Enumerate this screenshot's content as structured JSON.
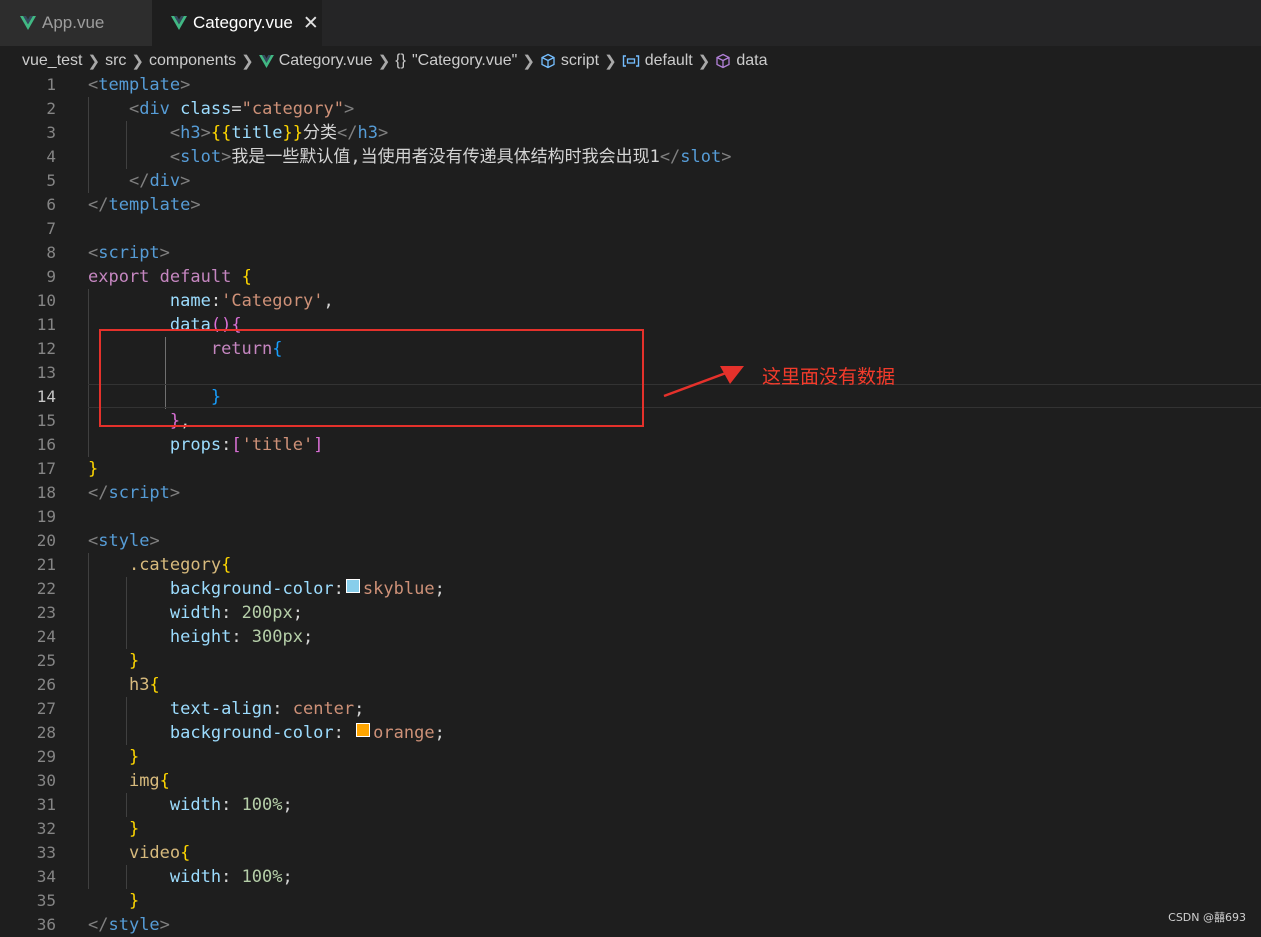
{
  "tabs": [
    {
      "label": "App.vue",
      "active": false,
      "icon": "vue-icon"
    },
    {
      "label": "Category.vue",
      "active": true,
      "icon": "vue-icon",
      "close": "✕"
    }
  ],
  "breadcrumb": {
    "project": "vue_test",
    "src": "src",
    "components": "components",
    "file": "Category.vue",
    "module_braces": "{}",
    "module": "\"Category.vue\"",
    "script": "script",
    "default": "default",
    "data": "data"
  },
  "code": {
    "line_numbers": [
      "1",
      "2",
      "3",
      "4",
      "5",
      "6",
      "7",
      "8",
      "9",
      "10",
      "11",
      "12",
      "13",
      "14",
      "15",
      "16",
      "17",
      "18",
      "19",
      "20",
      "21",
      "22",
      "23",
      "24",
      "25",
      "26",
      "27",
      "28",
      "29",
      "30",
      "31",
      "32",
      "33",
      "34",
      "35",
      "36"
    ],
    "current_line": "14",
    "l1": {
      "open": "<",
      "tag": "template",
      "close": ">"
    },
    "l2": {
      "open": "<",
      "tag": "div",
      "attr": "class",
      "eq": "=",
      "val": "\"category\"",
      "close": ">"
    },
    "l3": {
      "open": "<",
      "tag": "h3",
      "close": ">",
      "mopen": "{{",
      "var": "title",
      "mclose": "}}",
      "text": "分类",
      "eopen": "</",
      "etag": "h3",
      "eclose": ">"
    },
    "l4": {
      "open": "<",
      "tag": "slot",
      "close": ">",
      "text": "我是一些默认值,当使用者没有传递具体结构时我会出现1",
      "eopen": "</",
      "etag": "slot",
      "eclose": ">"
    },
    "l5": {
      "open": "</",
      "tag": "div",
      "close": ">"
    },
    "l6": {
      "open": "</",
      "tag": "template",
      "close": ">"
    },
    "l8": {
      "open": "<",
      "tag": "script",
      "close": ">"
    },
    "l9": {
      "kw1": "export",
      "kw2": "default",
      "brace": "{"
    },
    "l10": {
      "prop": "name",
      "colon": ":",
      "val": "'Category'",
      "comma": ","
    },
    "l11": {
      "fn": "data",
      "parens": "()",
      "brace": "{"
    },
    "l12": {
      "kw": "return",
      "brace": "{"
    },
    "l14": {
      "brace": "}"
    },
    "l15": {
      "brace": "}",
      "comma": ","
    },
    "l16": {
      "prop": "props",
      "colon": ":",
      "lb": "[",
      "val": "'title'",
      "rb": "]"
    },
    "l17": {
      "brace": "}"
    },
    "l18": {
      "open": "</",
      "tag": "script",
      "close": ">"
    },
    "l20": {
      "open": "<",
      "tag": "style",
      "close": ">"
    },
    "l21": {
      "sel": ".category",
      "brace": "{"
    },
    "l22": {
      "prop": "background-color",
      "colon": ":",
      "val": "skyblue",
      "semi": ";",
      "swatch": "#87ceeb"
    },
    "l23": {
      "prop": "width",
      "colon": ": ",
      "val": "200px",
      "semi": ";"
    },
    "l24": {
      "prop": "height",
      "colon": ": ",
      "val": "300px",
      "semi": ";"
    },
    "l25": {
      "brace": "}"
    },
    "l26": {
      "sel": "h3",
      "brace": "{"
    },
    "l27": {
      "prop": "text-align",
      "colon": ": ",
      "val": "center",
      "semi": ";"
    },
    "l28": {
      "prop": "background-color",
      "colon": ": ",
      "val": "orange",
      "semi": ";",
      "swatch": "#ffa500"
    },
    "l29": {
      "brace": "}"
    },
    "l30": {
      "sel": "img",
      "brace": "{"
    },
    "l31": {
      "prop": "width",
      "colon": ": ",
      "val": "100%",
      "semi": ";"
    },
    "l32": {
      "brace": "}"
    },
    "l33": {
      "sel": "video",
      "brace": "{"
    },
    "l34": {
      "prop": "width",
      "colon": ": ",
      "val": "100%",
      "semi": ";"
    },
    "l35": {
      "brace": "}"
    },
    "l36": {
      "open": "</",
      "tag": "style",
      "close": ">"
    }
  },
  "annotation": {
    "text": "这里面没有数据",
    "color": "#e5312b"
  },
  "watermark": "CSDN @囍693",
  "colors": {
    "background": "#1e1e1e",
    "tabbar": "#252526",
    "tag": "#569cd6",
    "string": "#ce9178",
    "keyword": "#c586c0",
    "property": "#9cdcfe",
    "number": "#b5cea8",
    "selector": "#d7ba7d"
  }
}
